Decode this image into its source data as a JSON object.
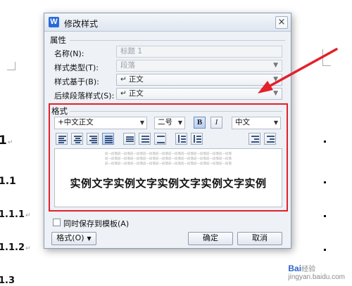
{
  "document": {
    "headings": [
      {
        "text": "1"
      },
      {
        "text": "1.1"
      },
      {
        "text": "1.1.1"
      },
      {
        "text": "1.1.2"
      },
      {
        "text": "1.3"
      }
    ],
    "para_mark": "↵"
  },
  "dialog": {
    "title": "修改样式",
    "app_icon": "W",
    "close_glyph": "×",
    "properties_group": "属性",
    "name_label": "名称(N):",
    "name_value": "标题 1",
    "style_type_label": "样式类型(T):",
    "style_type_value": "段落",
    "based_on_label": "样式基于(B):",
    "based_on_value": "正文",
    "next_style_label": "后续段落样式(S):",
    "next_style_value": "正文",
    "enter_glyph": "↵",
    "format_group": "格式",
    "font_name": "+中文正文",
    "font_size": "二号",
    "bold_label": "B",
    "italic_label": "I",
    "language": "中文",
    "preview_filler": "前一段落前一段落前一段落前一段落前一段落前一段落前一段落前一段落前一段落前一段落",
    "preview_sample": "实例文字实例文字实例文字实例文字实例",
    "save_to_template_label": "同时保存到模板(A)",
    "format_menu_label": "格式(O)",
    "ok_label": "确定",
    "cancel_label": "取消"
  },
  "colors": {
    "highlight": "#e3202b",
    "accent": "#2a6ad8"
  },
  "watermark": {
    "brand": "Bai",
    "brand_suffix": "经验",
    "url": "jingyan.baidu.com"
  }
}
